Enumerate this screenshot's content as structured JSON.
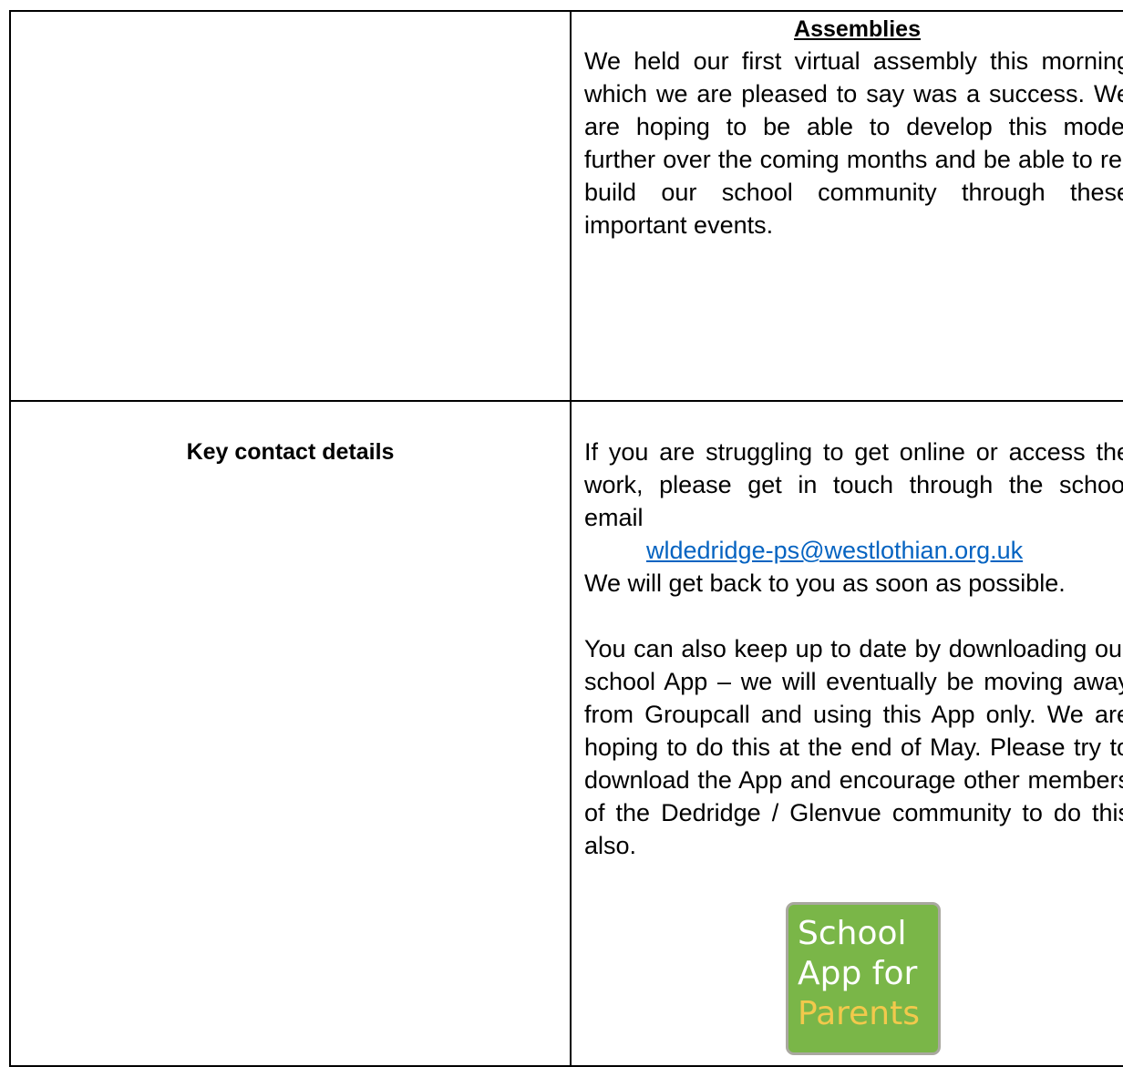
{
  "assemblies": {
    "title": "Assemblies",
    "body": "We held our first virtual assembly this morning which we are pleased to say was a success. We are hoping to be able to develop this model further over the coming months and be able to re-build our school community through these important events."
  },
  "contact": {
    "heading": "Key contact details",
    "intro": "If you are struggling to get online or access the work, please get in touch through the school email",
    "email": "wldedridge-ps@westlothian.org.uk",
    "followup": "We will get back to you as soon as possible.",
    "app_paragraph": "You can also keep up to date by downloading our school App – we will eventually be moving away from Groupcall and using this App only. We are hoping to do this at the end of May. Please try to download the App and encourage other members of the Dedridge / Glenvue community to do this also."
  },
  "app_logo": {
    "line1": "School",
    "line2": "App for",
    "line3": "Parents",
    "colors": {
      "background": "#7ab648",
      "text": "#ffffff",
      "highlight": "#f2c94c"
    }
  },
  "colors": {
    "link": "#0563c1",
    "border": "#000000"
  }
}
